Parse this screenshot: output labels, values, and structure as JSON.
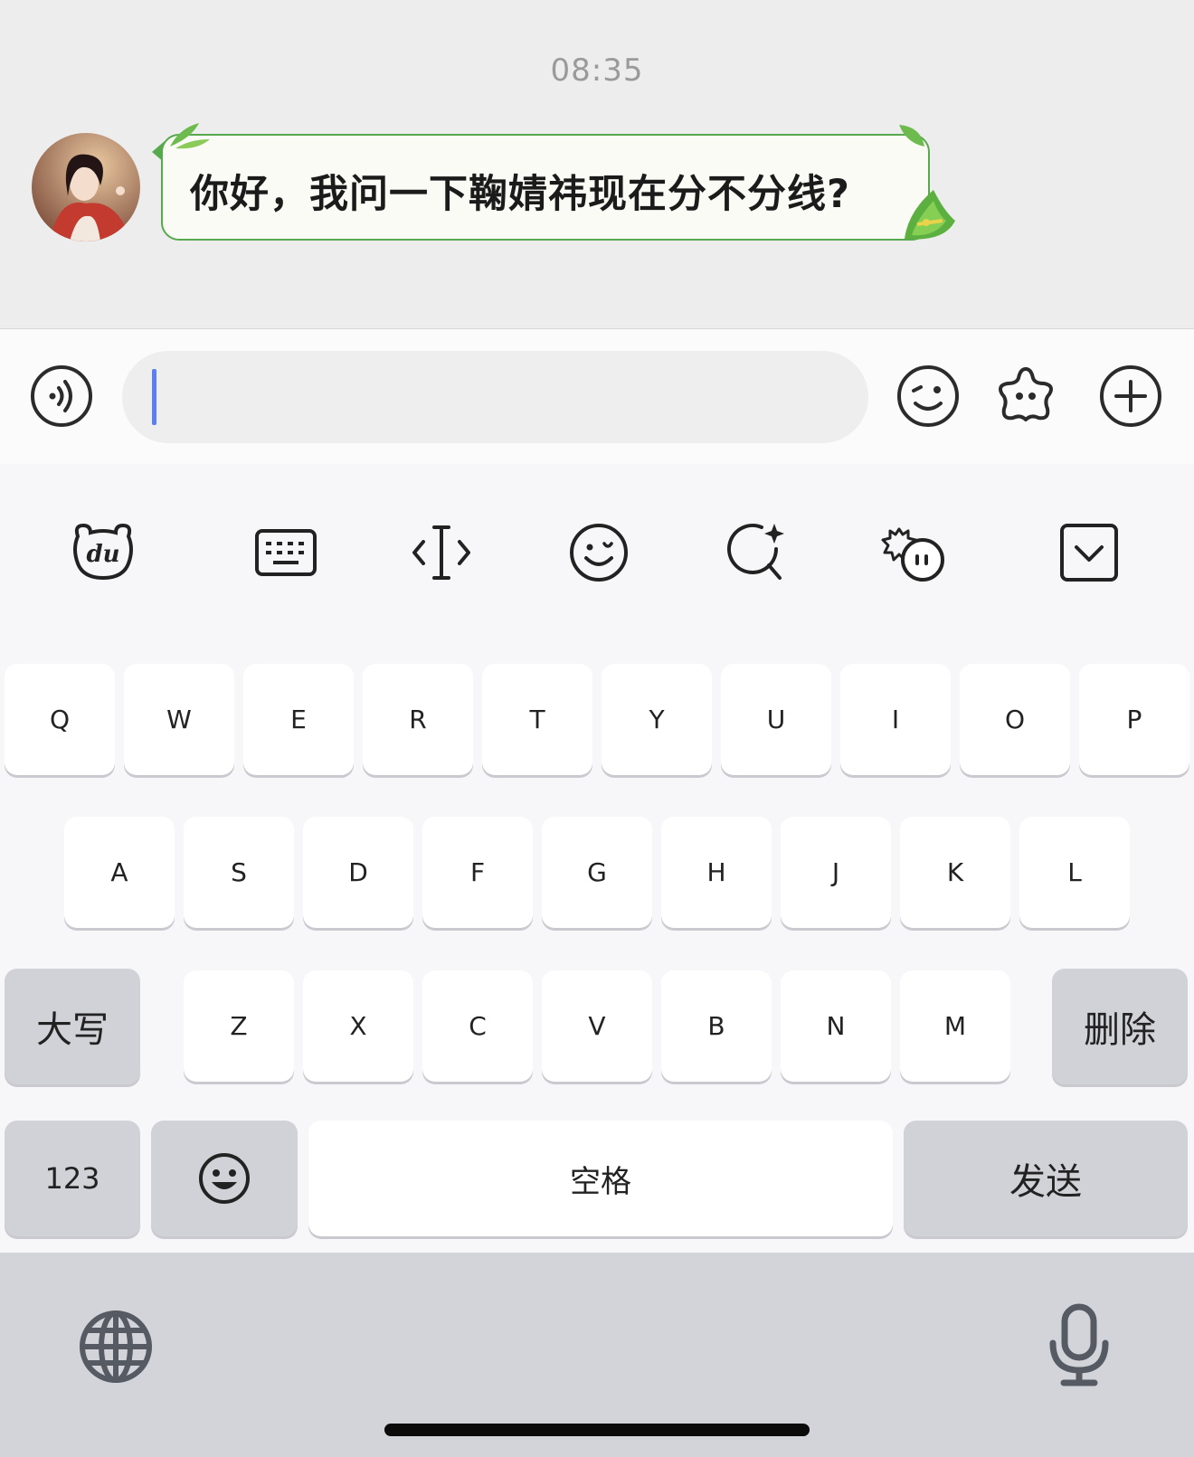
{
  "chat": {
    "timestamp": "08:35",
    "messages": [
      {
        "sender": "other",
        "text": "你好，我问一下鞠婧祎现在分不分线?"
      }
    ]
  },
  "input_bar": {
    "message_value": "",
    "voice_icon": "voice-icon",
    "emoji_icon": "emoji-icon",
    "sticker_icon": "sticker-star-icon",
    "more_icon": "plus-circle-icon"
  },
  "keyboard_toolbar": {
    "items": [
      "du-logo-icon",
      "keyboard-icon",
      "cursor-move-icon",
      "smile-icon",
      "ai-search-icon",
      "emoticon-icon",
      "collapse-keyboard-icon"
    ]
  },
  "keyboard": {
    "row1": [
      "Q",
      "W",
      "E",
      "R",
      "T",
      "Y",
      "U",
      "I",
      "O",
      "P"
    ],
    "row2": [
      "A",
      "S",
      "D",
      "F",
      "G",
      "H",
      "J",
      "K",
      "L"
    ],
    "row3": [
      "Z",
      "X",
      "C",
      "V",
      "B",
      "N",
      "M"
    ],
    "shift_label": "大写",
    "delete_label": "删除",
    "numbers_label": "123",
    "space_label": "空格",
    "send_label": "发送",
    "emoji_key_icon": "grin-icon"
  },
  "system_bar": {
    "globe_icon": "globe-icon",
    "mic_icon": "microphone-icon"
  },
  "colors": {
    "bubble_border": "#57a94e",
    "caret": "#5a7ff0",
    "chat_bg": "#ededed",
    "key_dark": "#d1d1d8"
  }
}
